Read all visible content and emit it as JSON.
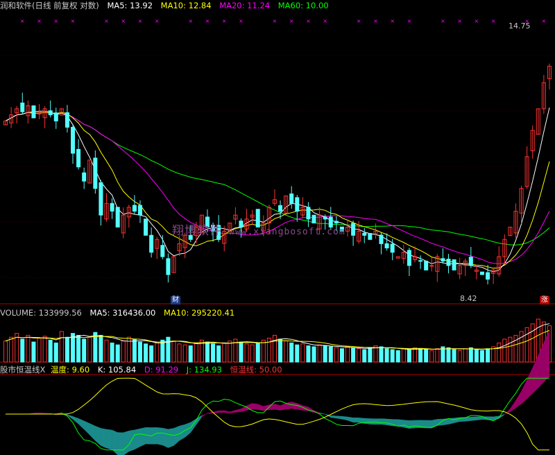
{
  "main_header": {
    "title": "润和软件(日线 前复权 对数)",
    "ma5": "MA5: 13.92",
    "ma10": "MA10: 12.84",
    "ma20": "MA20: 11.24",
    "ma60": "MA60: 10.00"
  },
  "volume_header": {
    "title": "VOLUME: 133999.56",
    "ma5": "MA5: 316436.00",
    "ma10": "MA10: 295220.41"
  },
  "indicator_header": {
    "title": "股市恒温线X",
    "wendu": "温度: 9.60",
    "k": "K: 105.84",
    "d": "D: 91.29",
    "j": "J: 134.93",
    "hengwen": "恒温线: 50.00"
  },
  "annotations": {
    "high_label": "14.75",
    "low_label": "8.42",
    "cai_marker": "财",
    "zhang_marker": "涨"
  },
  "watermark": {
    "cn": "翔博软件",
    "url": "www.xiangbosoft.com"
  },
  "colors": {
    "background": "#000000",
    "up": "#ff3232",
    "down": "#54ffff",
    "ma5": "#ffffff",
    "ma10": "#ffff00",
    "ma20": "#ff00ff",
    "ma60": "#00ff00",
    "band_up": "#990066",
    "band_down": "#1a8a8a",
    "gridline": "#a00000"
  },
  "chart_data": [
    {
      "type": "candlestick",
      "title": "润和软件(日线 前复权 对数)",
      "y_scale": "log",
      "ylim": [
        8.0,
        16.0
      ],
      "low_value": 8.42,
      "high_value": 14.75,
      "series_names": [
        "MA5",
        "MA10",
        "MA20",
        "MA60"
      ],
      "last_values": {
        "MA5": 13.92,
        "MA10": 12.84,
        "MA20": 11.24,
        "MA60": 10.0
      },
      "closes": [
        12.6,
        12.8,
        13.0,
        12.9,
        13.1,
        12.7,
        12.9,
        13.0,
        12.8,
        12.6,
        13.0,
        12.4,
        11.6,
        11.2,
        10.8,
        11.4,
        10.6,
        9.9,
        10.2,
        10.0,
        9.6,
        9.9,
        10.1,
        10.0,
        9.9,
        9.4,
        9.0,
        9.3,
        8.9,
        8.5,
        8.9,
        9.2,
        9.4,
        9.3,
        9.6,
        9.9,
        9.6,
        9.5,
        9.3,
        9.5,
        9.7,
        9.9,
        9.6,
        9.8,
        9.9,
        9.6,
        9.7,
        10.1,
        10.3,
        10.0,
        10.4,
        10.2,
        10.0,
        10.1,
        9.8,
        9.7,
        9.9,
        9.8,
        9.6,
        9.7,
        9.5,
        9.6,
        9.4,
        9.5,
        9.4,
        9.3,
        9.5,
        9.2,
        9.1,
        9.0,
        8.9,
        9.0,
        8.7,
        8.9,
        8.8,
        8.6,
        8.7,
        8.9,
        8.8,
        8.7,
        8.6,
        8.7,
        8.8,
        8.7,
        8.6,
        8.5,
        8.4,
        8.6,
        8.9,
        9.3,
        9.6,
        10.0,
        10.6,
        11.5,
        12.3,
        13.0,
        13.9,
        14.5
      ]
    },
    {
      "type": "bar",
      "title": "VOLUME",
      "value": 133999.56,
      "series_names": [
        "MA5",
        "MA10"
      ],
      "last_values": {
        "MA5": 316436.0,
        "MA10": 295220.41
      },
      "values": [
        220,
        260,
        300,
        240,
        280,
        210,
        250,
        270,
        230,
        200,
        320,
        260,
        300,
        280,
        240,
        260,
        310,
        280,
        230,
        200,
        180,
        220,
        260,
        240,
        210,
        190,
        170,
        200,
        230,
        260,
        220,
        190,
        180,
        170,
        200,
        230,
        210,
        190,
        170,
        200,
        220,
        240,
        210,
        190,
        180,
        200,
        230,
        250,
        280,
        240,
        220,
        200,
        180,
        190,
        170,
        160,
        180,
        170,
        160,
        150,
        140,
        160,
        150,
        140,
        130,
        150,
        170,
        160,
        140,
        130,
        120,
        140,
        130,
        150,
        140,
        130,
        120,
        140,
        160,
        150,
        130,
        120,
        140,
        150,
        130,
        120,
        140,
        160,
        200,
        240,
        260,
        280,
        320,
        360,
        400,
        450,
        420,
        380
      ]
    },
    {
      "type": "line",
      "title": "股市恒温线X",
      "series_names": [
        "温度",
        "K",
        "D",
        "J",
        "恒温线"
      ],
      "last_values": {
        "温度": 9.6,
        "K": 105.84,
        "D": 91.29,
        "J": 134.93,
        "恒温线": 50.0
      }
    }
  ]
}
